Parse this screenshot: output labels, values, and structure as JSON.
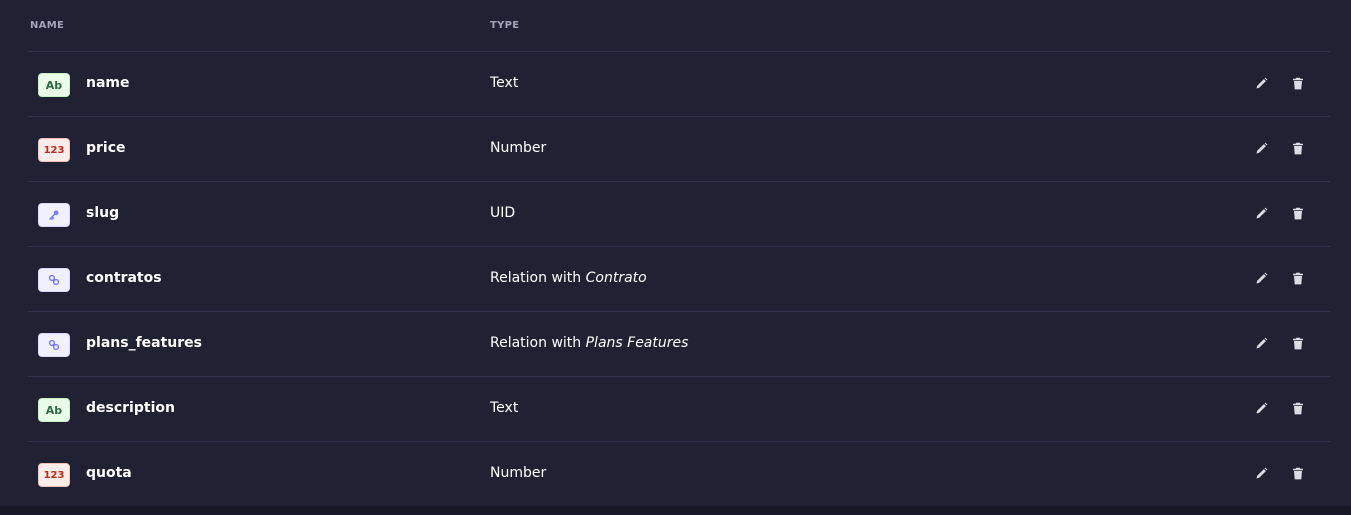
{
  "table": {
    "header": {
      "name": "NAME",
      "type": "TYPE"
    },
    "rows": [
      {
        "icon": "text-icon",
        "icon_label": "Ab",
        "icon_style": "icon-text",
        "name": "name",
        "type": "Text",
        "type_target": ""
      },
      {
        "icon": "number-icon",
        "icon_label": "123",
        "icon_style": "icon-number",
        "name": "price",
        "type": "Number",
        "type_target": ""
      },
      {
        "icon": "key-icon",
        "icon_label": "",
        "icon_style": "icon-uid",
        "name": "slug",
        "type": "UID",
        "type_target": ""
      },
      {
        "icon": "link-icon",
        "icon_label": "",
        "icon_style": "icon-relation",
        "name": "contratos",
        "type": "Relation with ",
        "type_target": "Contrato"
      },
      {
        "icon": "link-icon",
        "icon_label": "",
        "icon_style": "icon-relation",
        "name": "plans_features",
        "type": "Relation with ",
        "type_target": "Plans Features"
      },
      {
        "icon": "text-icon",
        "icon_label": "Ab",
        "icon_style": "icon-text",
        "name": "description",
        "type": "Text",
        "type_target": ""
      },
      {
        "icon": "number-icon",
        "icon_label": "123",
        "icon_style": "icon-number",
        "name": "quota",
        "type": "Number",
        "type_target": ""
      }
    ]
  },
  "actions": {
    "edit_icon": "pencil-icon",
    "delete_icon": "trash-icon"
  },
  "colors": {
    "background": "#212134",
    "divider": "#32324d",
    "header_text": "#a5a5ba",
    "action_icon": "#dcdce4"
  }
}
